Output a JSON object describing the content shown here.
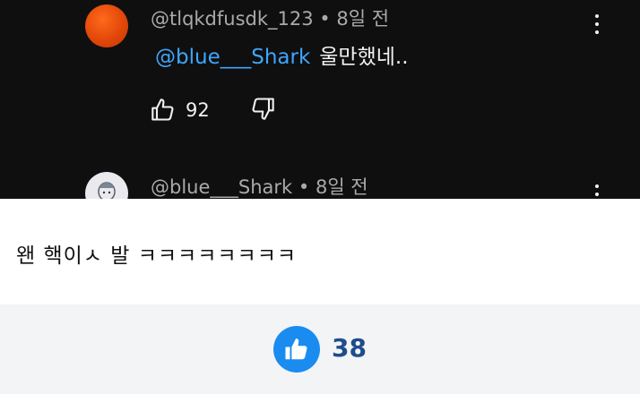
{
  "comment1": {
    "handle": "@tlqkdfusdk_123",
    "time": "8일 전",
    "mention": "@blue___Shark",
    "text": "울만했네..",
    "like_count": "92"
  },
  "comment2": {
    "handle": "@blue___Shark",
    "time": "8일 전"
  },
  "post": {
    "text": "왠 핵이ㅅ 발 ㅋㅋㅋㅋㅋㅋㅋㅋ",
    "like_count": "38"
  },
  "colors": {
    "dark_bg": "#0f0f0f",
    "mention_blue": "#3ea6ff",
    "like_blue": "#1a8cf0",
    "count_navy": "#1e4d8c"
  },
  "icons": [
    "thumbs-up-icon",
    "thumbs-down-icon",
    "more-vert-icon",
    "like-thumb-icon"
  ]
}
